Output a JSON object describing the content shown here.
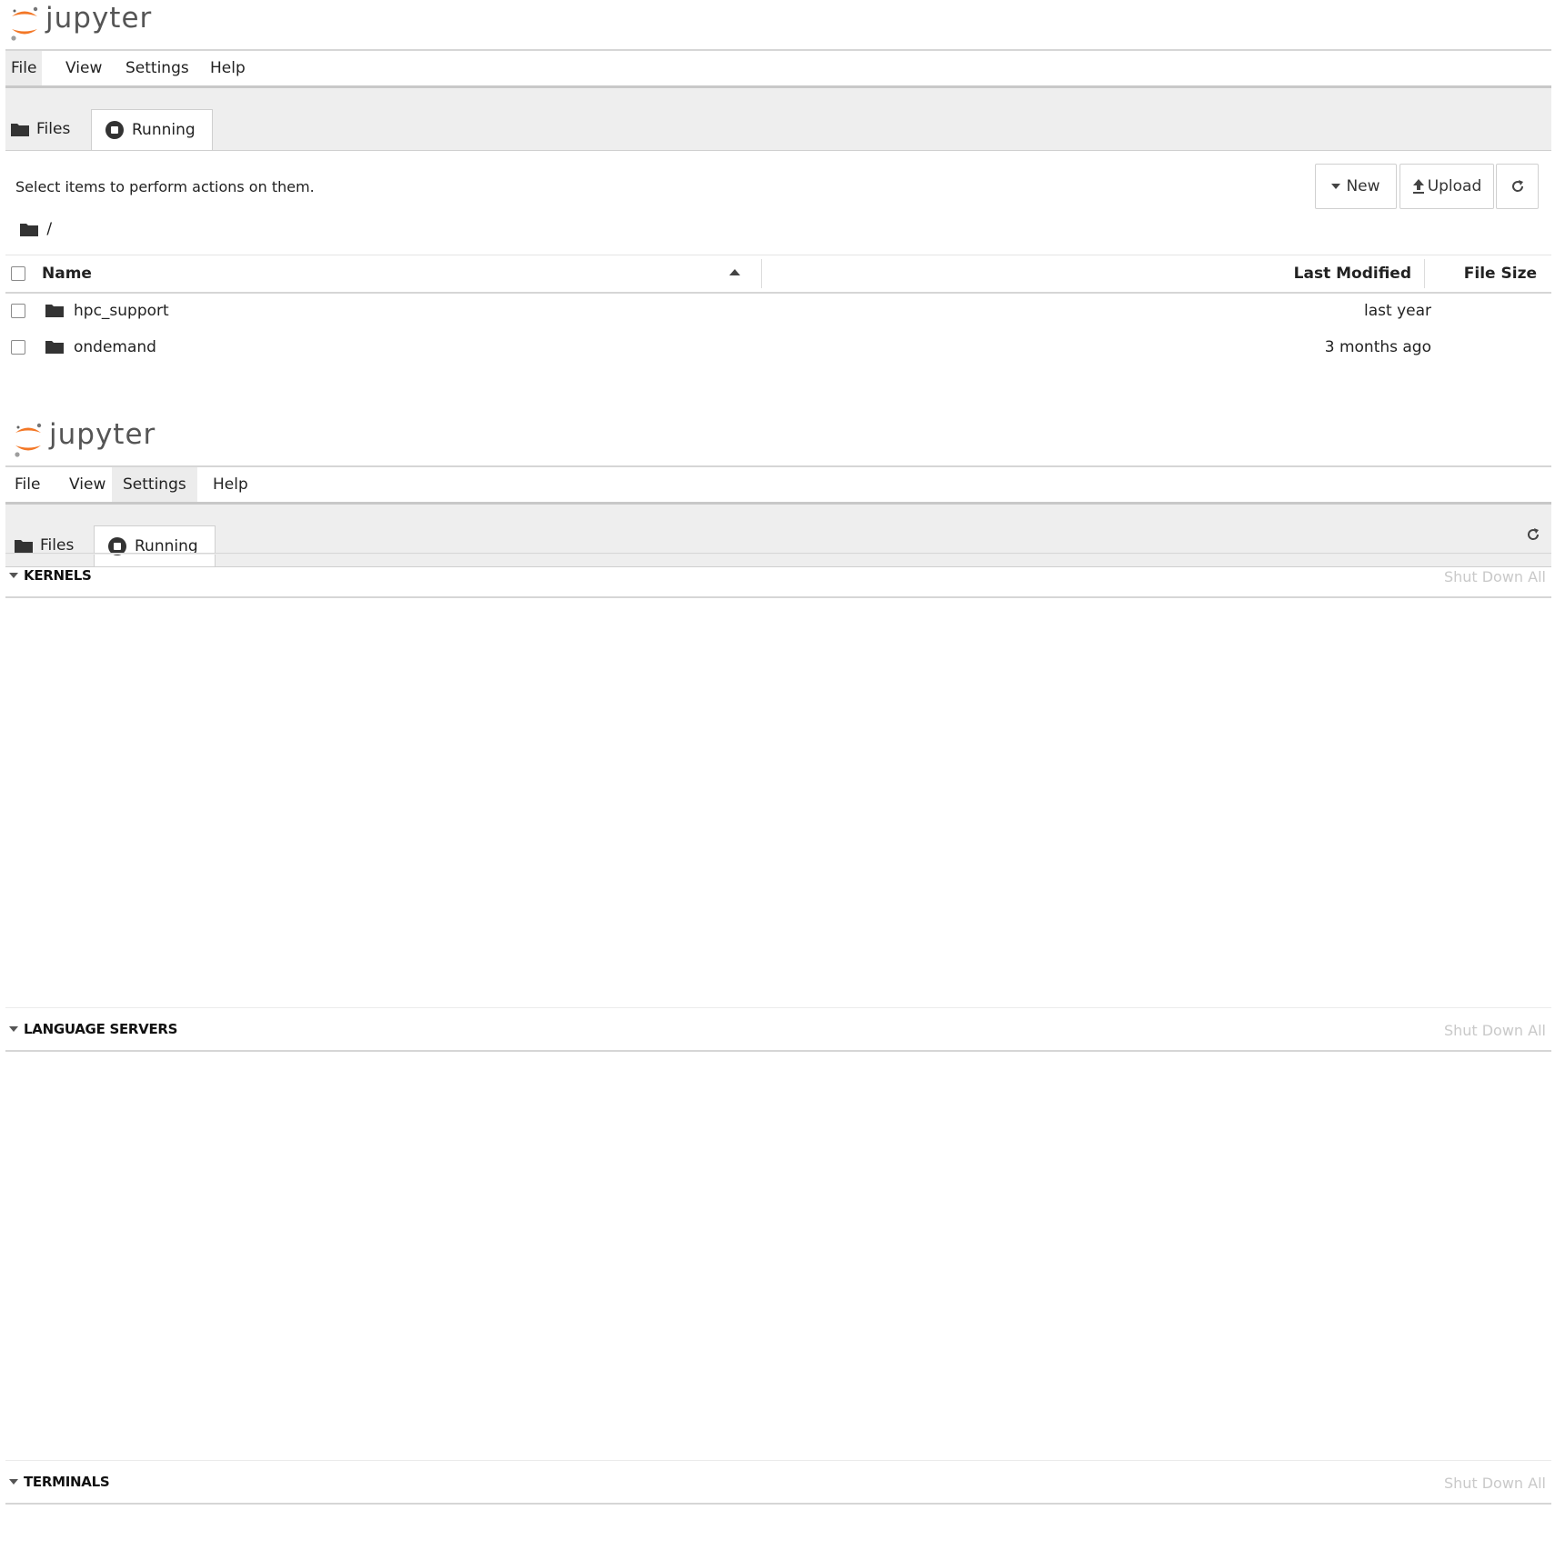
{
  "app": {
    "logo_text": "jupyter",
    "accent": "#f37726"
  },
  "menu": {
    "items": [
      "File",
      "View",
      "Settings",
      "Help"
    ]
  },
  "tabs": {
    "files": "Files",
    "running": "Running"
  },
  "files_view": {
    "status": "Select items to perform actions on them.",
    "buttons": {
      "new": "New",
      "upload": "Upload"
    },
    "breadcrumb": "/",
    "columns": {
      "name": "Name",
      "last_modified": "Last Modified",
      "file_size": "File Size"
    },
    "rows": [
      {
        "name": "hpc_support",
        "modified": "last year",
        "size": ""
      },
      {
        "name": "ondemand",
        "modified": "3 months ago",
        "size": ""
      }
    ]
  },
  "running_view": {
    "sections": [
      {
        "title": "KERNELS",
        "action": "Shut Down All"
      },
      {
        "title": "LANGUAGE SERVERS",
        "action": "Shut Down All"
      },
      {
        "title": "TERMINALS",
        "action": "Shut Down All"
      }
    ]
  }
}
